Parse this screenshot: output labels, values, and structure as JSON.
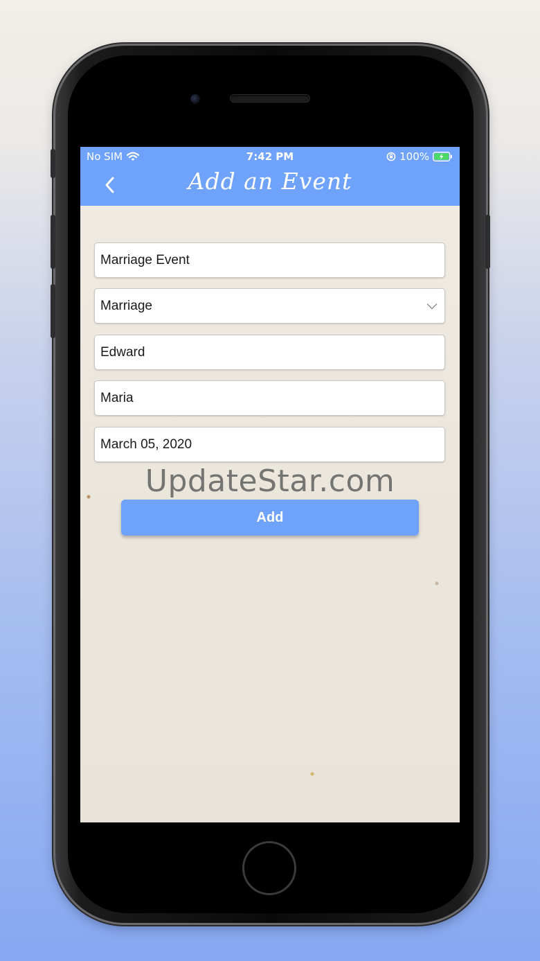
{
  "status_bar": {
    "carrier": "No SIM",
    "time": "7:42 PM",
    "battery_percent": "100%",
    "icons": [
      "wifi-icon",
      "orientation-lock-icon",
      "battery-charging-icon"
    ]
  },
  "nav": {
    "title": "Add an Event",
    "back_icon": "chevron-left-icon"
  },
  "form": {
    "event_name": "Marriage Event",
    "event_type": "Marriage",
    "event_type_icon": "chevron-down-icon",
    "person_one": "Edward",
    "person_two": "Maria",
    "date": "March 05, 2020"
  },
  "add_button": {
    "label": "Add"
  },
  "watermark": "UpdateStar.com",
  "colors": {
    "accent": "#6fa2fb",
    "paper": "#ece7dd"
  }
}
